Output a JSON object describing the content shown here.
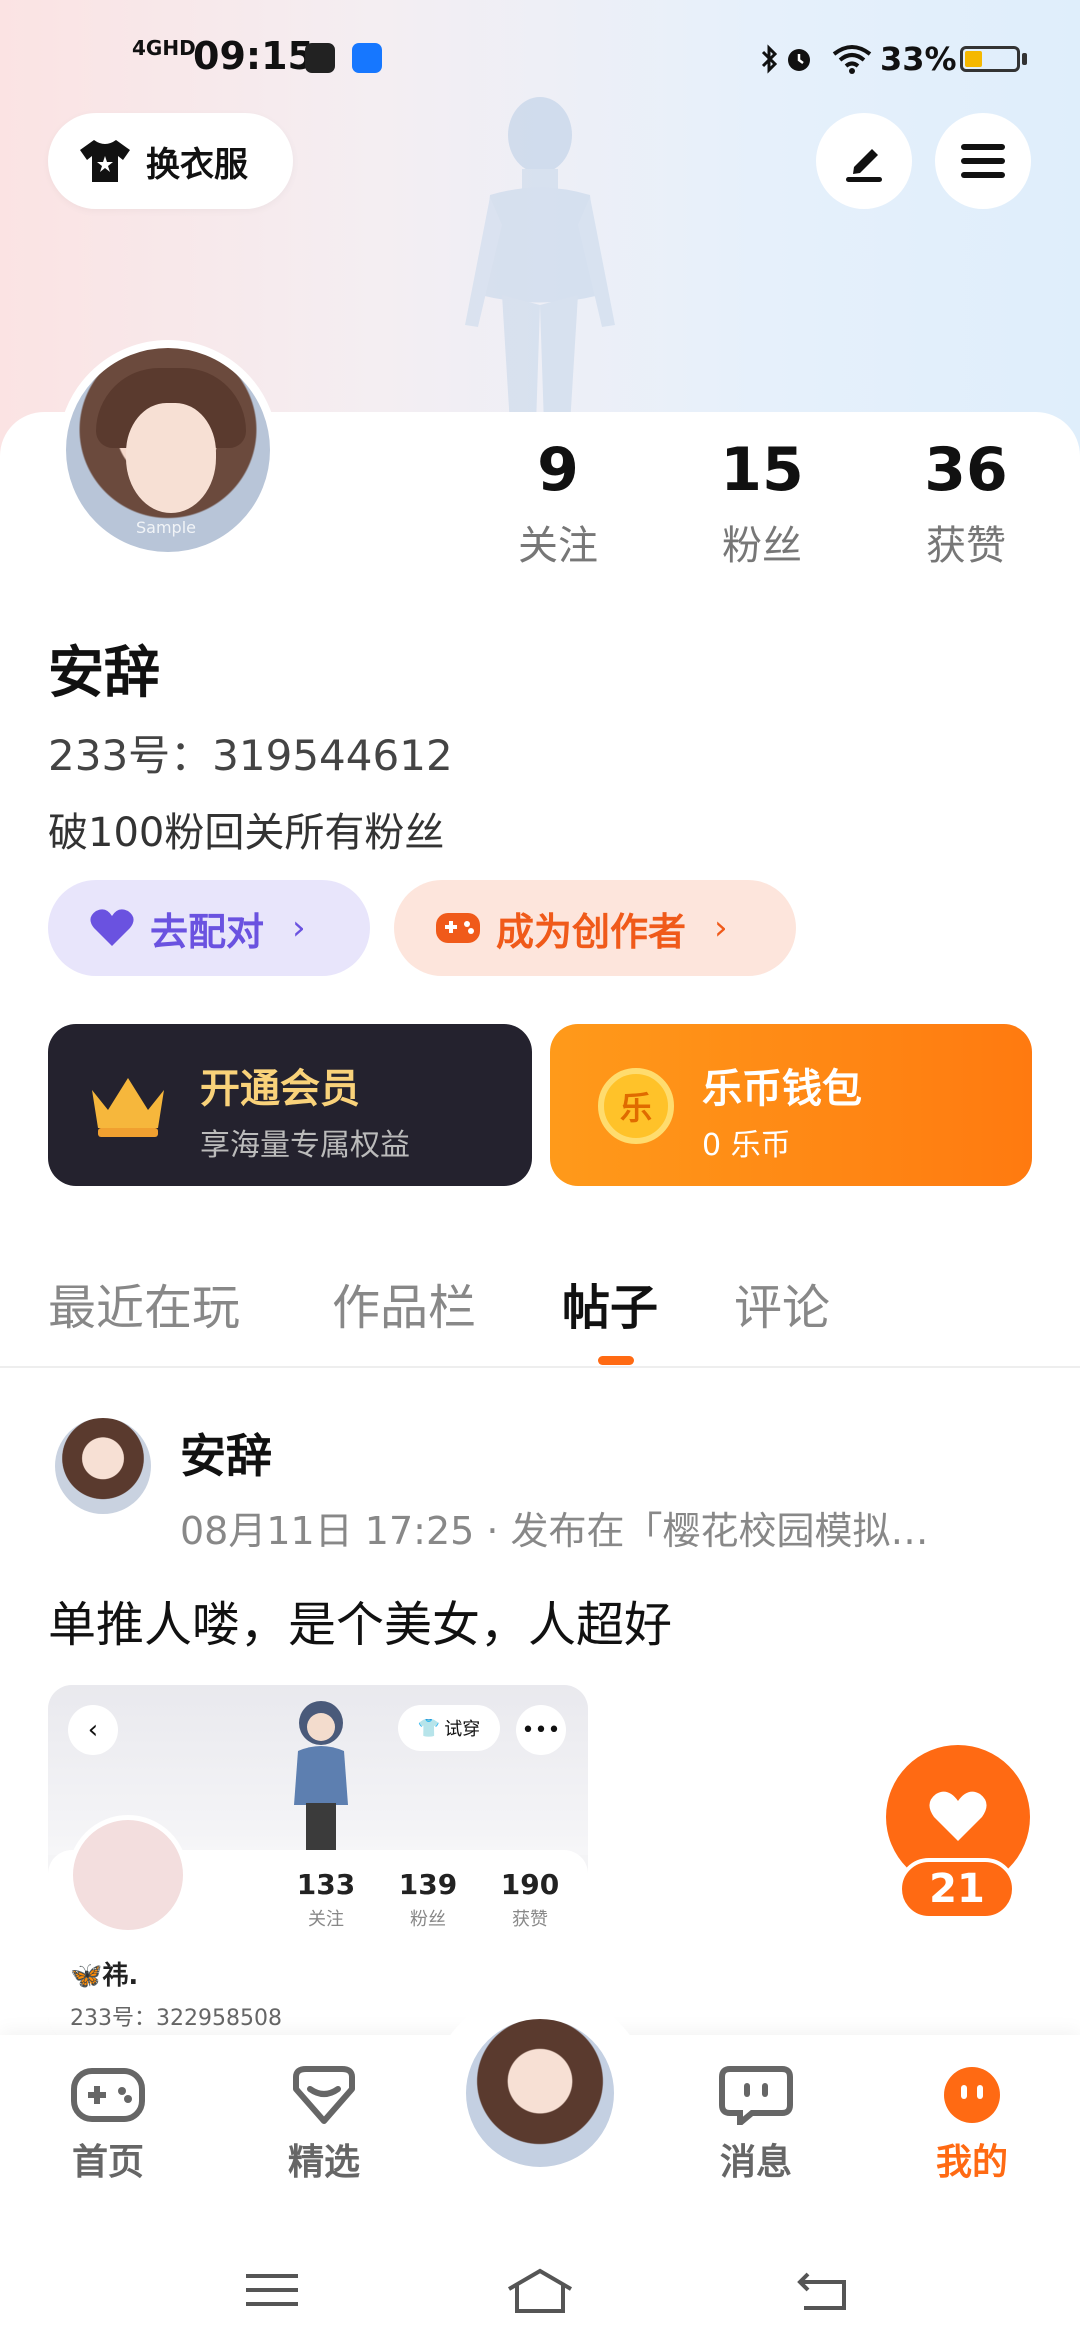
{
  "status_bar": {
    "signal": "4GHD",
    "time": "09:15",
    "battery_text": "33%",
    "battery_level": 0.33
  },
  "top_bar": {
    "outfit_label": "换衣服"
  },
  "profile": {
    "name": "安辞",
    "id_text": "233号：319544612",
    "bio": "破100粉回关所有粉丝",
    "stats": [
      {
        "num": "9",
        "label": "关注"
      },
      {
        "num": "15",
        "label": "粉丝"
      },
      {
        "num": "36",
        "label": "获赞"
      }
    ],
    "avatar_watermark": "Sample",
    "pair_label": "去配对",
    "creator_label": "成为创作者"
  },
  "cards": {
    "vip_title": "开通会员",
    "vip_sub": "享海量专属权益",
    "wallet_title": "乐币钱包",
    "wallet_sub": "0 乐币",
    "wallet_coin": "乐"
  },
  "tabs": [
    {
      "label": "最近在玩",
      "active": false
    },
    {
      "label": "作品栏",
      "active": false
    },
    {
      "label": "帖子",
      "active": true
    },
    {
      "label": "评论",
      "active": false
    }
  ],
  "post": {
    "author": "安辞",
    "meta": "08月11日 17:25 · 发布在「樱花校园模拟…",
    "text": "单推人喽，是个美女，人超好",
    "like_count": "21",
    "image": {
      "try_label": "试穿",
      "stats": [
        {
          "num": "133",
          "label": "关注"
        },
        {
          "num": "139",
          "label": "粉丝"
        },
        {
          "num": "190",
          "label": "获赞"
        }
      ],
      "name": "🦋祎.",
      "id_text": "233号：322958508"
    }
  },
  "bottom_nav": [
    {
      "label": "首页",
      "icon": "gamepad-icon",
      "active": false
    },
    {
      "label": "精选",
      "icon": "heart-outline-icon",
      "active": false
    },
    {
      "label": "消息",
      "icon": "chat-icon",
      "active": false
    },
    {
      "label": "我的",
      "icon": "face-icon",
      "active": true
    }
  ],
  "colors": {
    "accent": "#ff6a13",
    "vip_bg": "#24222e",
    "pair_color": "#6a52e0"
  }
}
